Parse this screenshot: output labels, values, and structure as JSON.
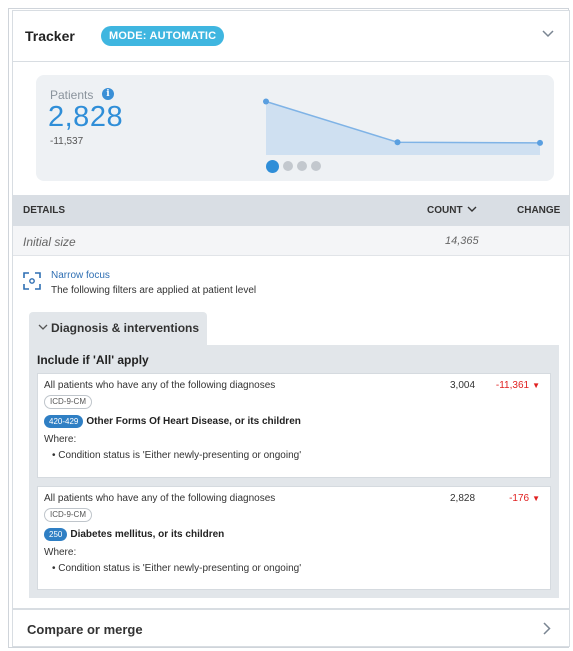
{
  "tracker": {
    "title": "Tracker",
    "mode_badge": "MODE: AUTOMATIC"
  },
  "stats": {
    "label": "Patients",
    "value": "2,828",
    "delta": "-11,537",
    "sparkline": [
      14365,
      3004,
      2828
    ],
    "pager_pages": 4,
    "pager_active": 1
  },
  "details": {
    "headers": {
      "details": "DETAILS",
      "count": "COUNT",
      "change": "CHANGE"
    },
    "initial": {
      "label": "Initial size",
      "value": "14,365"
    }
  },
  "focus": {
    "title": "Narrow focus",
    "subtitle": "The following filters are applied at patient level"
  },
  "tab": {
    "label": "Diagnosis & interventions"
  },
  "group": {
    "header": "Include if 'All' apply",
    "criteria": [
      {
        "description": "All patients who have any of the following diagnoses",
        "tag": "ICD-9-CM",
        "code": "420-429",
        "code_name": "Other Forms Of Heart Disease, or its children",
        "where": "Where:",
        "condition": "•  Condition status is 'Either newly-presenting or ongoing'",
        "count": "3,004",
        "change": "-11,361"
      },
      {
        "description": "All patients who have any of the following diagnoses",
        "tag": "ICD-9-CM",
        "code": "250",
        "code_name": "Diabetes mellitus, or its children",
        "where": "Where:",
        "condition": "•  Condition status is 'Either newly-presenting or ongoing'",
        "count": "2,828",
        "change": "-176"
      }
    ]
  },
  "footer": {
    "label": "Compare or merge"
  },
  "colors": {
    "accent": "#2f8ed8",
    "badge": "#3fb6e0",
    "negative": "#e02020",
    "code_pill": "#2f7fc4"
  }
}
